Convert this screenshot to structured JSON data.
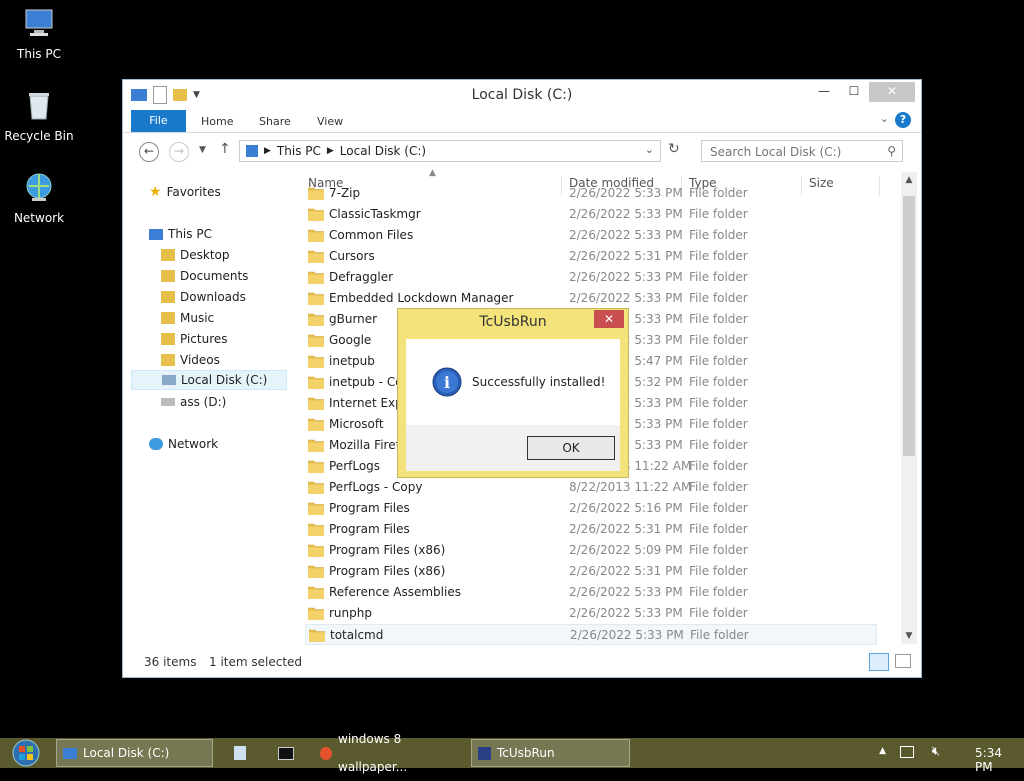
{
  "desktop": {
    "icons": [
      {
        "label": "This PC"
      },
      {
        "label": "Recycle Bin"
      },
      {
        "label": "Network"
      }
    ]
  },
  "window": {
    "title": "Local Disk (C:)",
    "ribbon": {
      "file": "File",
      "tabs": [
        "Home",
        "Share",
        "View"
      ]
    },
    "address": {
      "crumbs": [
        "This PC",
        "Local Disk (C:)"
      ]
    },
    "search": {
      "placeholder": "Search Local Disk (C:)"
    },
    "nav": {
      "favorites": "Favorites",
      "this_pc": "This PC",
      "items": [
        "Desktop",
        "Documents",
        "Downloads",
        "Music",
        "Pictures",
        "Videos"
      ],
      "local_disk": "Local Disk (C:)",
      "ass_drive": "ass (D:)",
      "network": "Network"
    },
    "columns": {
      "name": "Name",
      "date": "Date modified",
      "type": "Type",
      "size": "Size"
    },
    "files": [
      {
        "name": "7-Zip",
        "date": "2/26/2022 5:33 PM",
        "type": "File folder"
      },
      {
        "name": "ClassicTaskmgr",
        "date": "2/26/2022 5:33 PM",
        "type": "File folder"
      },
      {
        "name": "Common Files",
        "date": "2/26/2022 5:33 PM",
        "type": "File folder"
      },
      {
        "name": "Cursors",
        "date": "2/26/2022 5:31 PM",
        "type": "File folder"
      },
      {
        "name": "Defraggler",
        "date": "2/26/2022 5:33 PM",
        "type": "File folder"
      },
      {
        "name": "Embedded Lockdown Manager",
        "date": "2/26/2022 5:33 PM",
        "type": "File folder"
      },
      {
        "name": "gBurner",
        "date": "2/26/2022 5:33 PM",
        "type": "File folder"
      },
      {
        "name": "Google",
        "date": "2/26/2022 5:33 PM",
        "type": "File folder"
      },
      {
        "name": "inetpub",
        "date": "2/26/2022 5:47 PM",
        "type": "File folder"
      },
      {
        "name": "inetpub - Copy",
        "date": "2/26/2022 5:32 PM",
        "type": "File folder"
      },
      {
        "name": "Internet Explorer",
        "date": "2/26/2022 5:33 PM",
        "type": "File folder"
      },
      {
        "name": "Microsoft",
        "date": "2/26/2022 5:33 PM",
        "type": "File folder"
      },
      {
        "name": "Mozilla Firefox",
        "date": "2/26/2022 5:33 PM",
        "type": "File folder"
      },
      {
        "name": "PerfLogs",
        "date": "8/22/2013 11:22 AM",
        "type": "File folder"
      },
      {
        "name": "PerfLogs - Copy",
        "date": "8/22/2013 11:22 AM",
        "type": "File folder"
      },
      {
        "name": "Program Files",
        "date": "2/26/2022 5:16 PM",
        "type": "File folder"
      },
      {
        "name": "Program Files",
        "date": "2/26/2022 5:31 PM",
        "type": "File folder"
      },
      {
        "name": "Program Files (x86)",
        "date": "2/26/2022 5:09 PM",
        "type": "File folder"
      },
      {
        "name": "Program Files (x86)",
        "date": "2/26/2022 5:31 PM",
        "type": "File folder"
      },
      {
        "name": "Reference Assemblies",
        "date": "2/26/2022 5:33 PM",
        "type": "File folder"
      },
      {
        "name": "runphp",
        "date": "2/26/2022 5:33 PM",
        "type": "File folder"
      },
      {
        "name": "totalcmd",
        "date": "2/26/2022 5:33 PM",
        "type": "File folder"
      }
    ],
    "status": {
      "count": "36 items",
      "selected": "1 item selected"
    }
  },
  "dialog": {
    "title": "TcUsbRun",
    "message": "Successfully installed!",
    "ok": "OK"
  },
  "taskbar": {
    "items": [
      "Local Disk (C:)",
      "windows 8 wallpaper...",
      "TcUsbRun"
    ],
    "clock": "5:34 PM"
  },
  "colors": {
    "accent": "#1979ca",
    "dialog_frame": "#f3e37a",
    "taskbar": "#5a5a2e"
  }
}
